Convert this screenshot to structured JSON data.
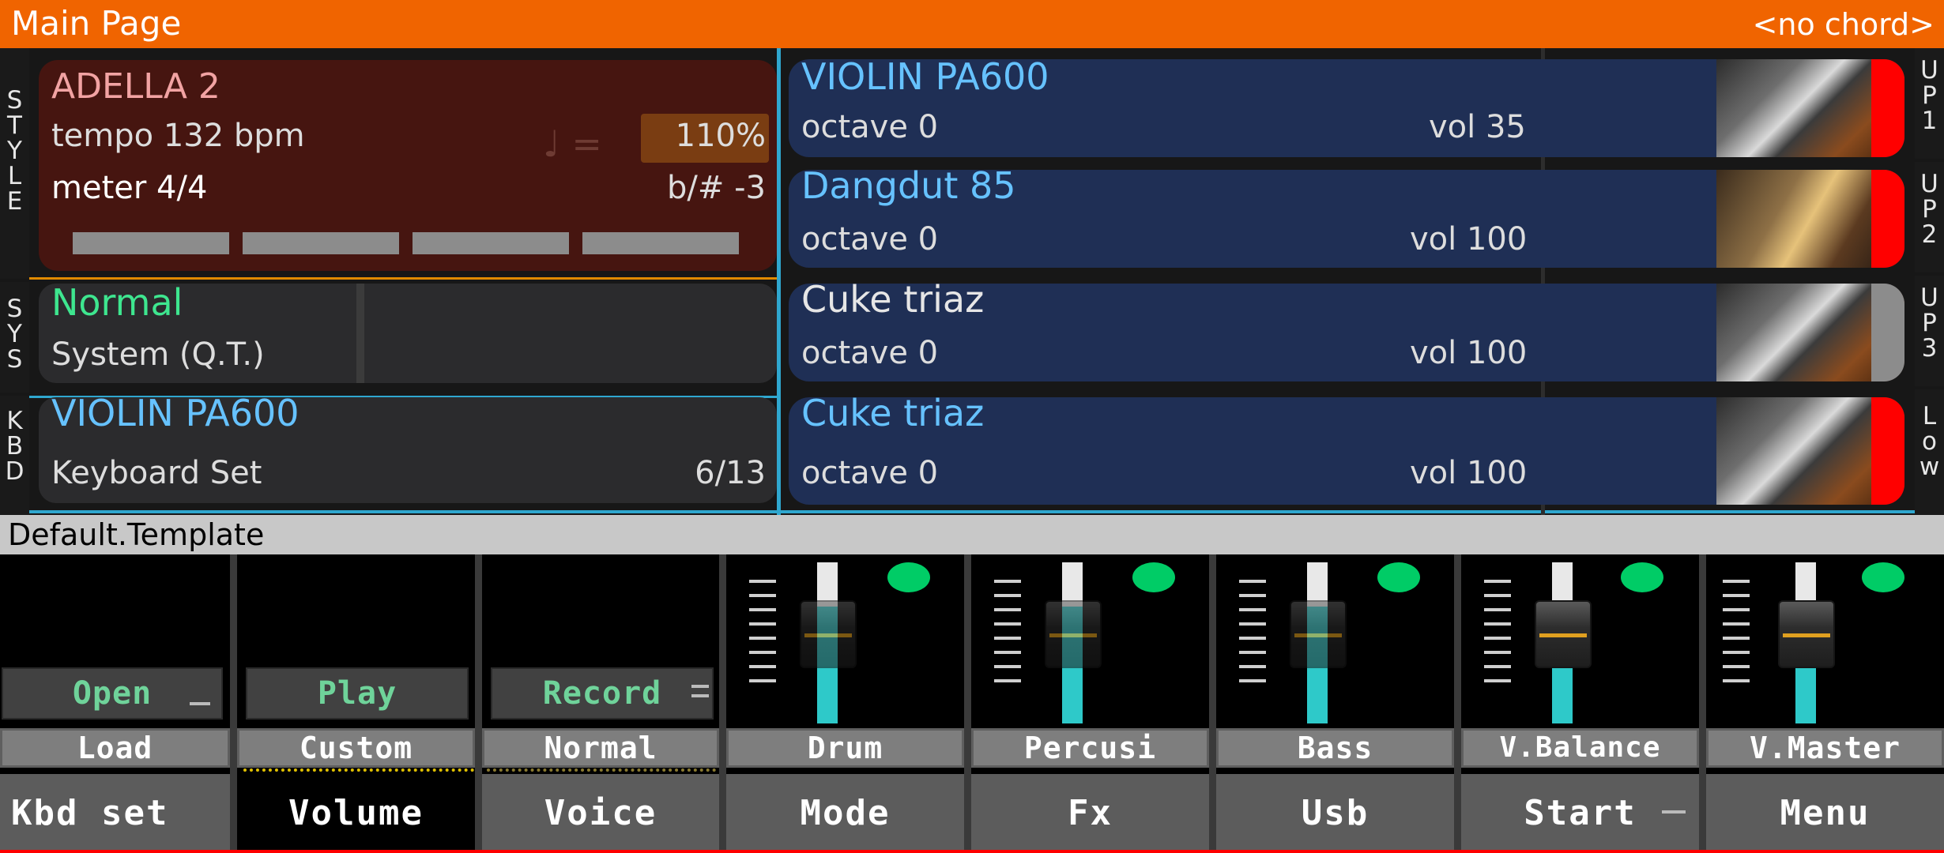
{
  "header": {
    "title": "Main Page",
    "chord": "<no chord>"
  },
  "side_tabs": {
    "style": [
      "S",
      "T",
      "Y",
      "L",
      "E"
    ],
    "sys": [
      "S",
      "Y",
      "S"
    ],
    "kbd": [
      "K",
      "B",
      "D"
    ]
  },
  "right_tabs": {
    "up1": [
      "U",
      "P",
      "1"
    ],
    "up2": [
      "U",
      "P",
      "2"
    ],
    "up3": [
      "U",
      "P",
      "3"
    ],
    "low": [
      "L",
      "o",
      "w"
    ]
  },
  "style": {
    "name": "ADELLA 2",
    "tempo": "tempo 132 bpm",
    "meter": "meter 4/4",
    "note_eq": "♩ =",
    "percent": "110%",
    "key": "b/# -3"
  },
  "sys": {
    "mode": "Normal",
    "label": "System (Q.T.)"
  },
  "kbd": {
    "name": "VIOLIN PA600",
    "label": "Keyboard Set",
    "count": "6/13"
  },
  "tracks": [
    {
      "name": "VIOLIN PA600",
      "octave": "octave  0",
      "vol": "vol 35",
      "color": "#66c2ff"
    },
    {
      "name": "Dangdut 85",
      "octave": "octave  0",
      "vol": "vol 100",
      "color": "#66c2ff"
    },
    {
      "name": "Cuke triaz",
      "octave": "octave  0",
      "vol": "vol 100",
      "color": "#e6e6e6"
    },
    {
      "name": "Cuke triaz",
      "octave": "octave  0",
      "vol": "vol 100",
      "color": "#66c2ff"
    }
  ],
  "template": "Default.Template",
  "pads": {
    "open": "Open",
    "play": "Play",
    "record": "Record"
  },
  "labels": [
    "Load",
    "Custom",
    "Normal",
    "Drum",
    "Percusi",
    "Bass",
    "V.Balance",
    "V.Master"
  ],
  "nav": [
    "Kbd set",
    "Volume",
    "Voice",
    "Mode",
    "Fx",
    "Usb",
    "Start",
    "Menu"
  ],
  "mixer": {
    "drum_level": 0.55,
    "percusi_level": 0.55,
    "bass_level": 0.55,
    "vbalance_level": 0.55,
    "vmaster_level": 0.55
  },
  "colors": {
    "header": "#f06400",
    "accent_green": "#00cc66",
    "indicator_red": "#ff0000",
    "cyan": "#2ec9c9"
  }
}
